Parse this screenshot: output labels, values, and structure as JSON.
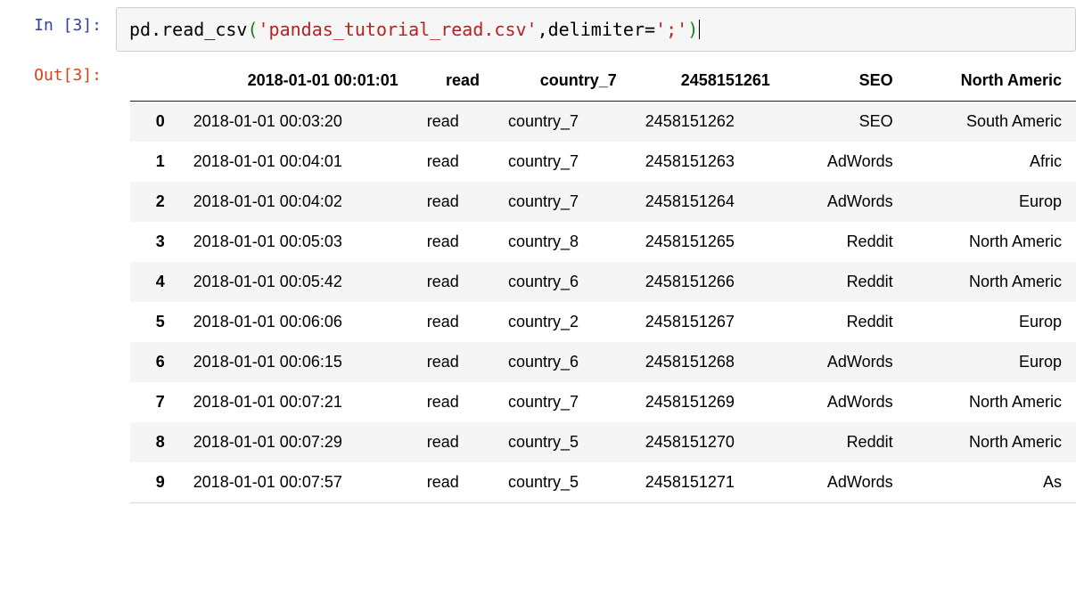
{
  "cell": {
    "in_prompt": "In [3]:",
    "out_prompt": "Out[3]:",
    "code": {
      "obj": "pd",
      "dot": ".",
      "func": "read_csv",
      "lparen": "(",
      "arg_string": "'pandas_tutorial_read.csv'",
      "comma_sp": ", ",
      "kwarg_name": "delimiter",
      "equals": "=",
      "kwarg_val": "';'",
      "rparen": ")"
    }
  },
  "dataframe": {
    "columns": [
      "2018-01-01 00:01:01",
      "read",
      "country_7",
      "2458151261",
      "SEO",
      "North Americ"
    ],
    "rows": [
      {
        "idx": "0",
        "c0": "2018-01-01 00:03:20",
        "c1": "read",
        "c2": "country_7",
        "c3": "2458151262",
        "c4": "SEO",
        "c5": "South Americ"
      },
      {
        "idx": "1",
        "c0": "2018-01-01 00:04:01",
        "c1": "read",
        "c2": "country_7",
        "c3": "2458151263",
        "c4": "AdWords",
        "c5": "Afric"
      },
      {
        "idx": "2",
        "c0": "2018-01-01 00:04:02",
        "c1": "read",
        "c2": "country_7",
        "c3": "2458151264",
        "c4": "AdWords",
        "c5": "Europ"
      },
      {
        "idx": "3",
        "c0": "2018-01-01 00:05:03",
        "c1": "read",
        "c2": "country_8",
        "c3": "2458151265",
        "c4": "Reddit",
        "c5": "North Americ"
      },
      {
        "idx": "4",
        "c0": "2018-01-01 00:05:42",
        "c1": "read",
        "c2": "country_6",
        "c3": "2458151266",
        "c4": "Reddit",
        "c5": "North Americ"
      },
      {
        "idx": "5",
        "c0": "2018-01-01 00:06:06",
        "c1": "read",
        "c2": "country_2",
        "c3": "2458151267",
        "c4": "Reddit",
        "c5": "Europ"
      },
      {
        "idx": "6",
        "c0": "2018-01-01 00:06:15",
        "c1": "read",
        "c2": "country_6",
        "c3": "2458151268",
        "c4": "AdWords",
        "c5": "Europ"
      },
      {
        "idx": "7",
        "c0": "2018-01-01 00:07:21",
        "c1": "read",
        "c2": "country_7",
        "c3": "2458151269",
        "c4": "AdWords",
        "c5": "North Americ"
      },
      {
        "idx": "8",
        "c0": "2018-01-01 00:07:29",
        "c1": "read",
        "c2": "country_5",
        "c3": "2458151270",
        "c4": "Reddit",
        "c5": "North Americ"
      },
      {
        "idx": "9",
        "c0": "2018-01-01 00:07:57",
        "c1": "read",
        "c2": "country_5",
        "c3": "2458151271",
        "c4": "AdWords",
        "c5": "As"
      }
    ]
  }
}
